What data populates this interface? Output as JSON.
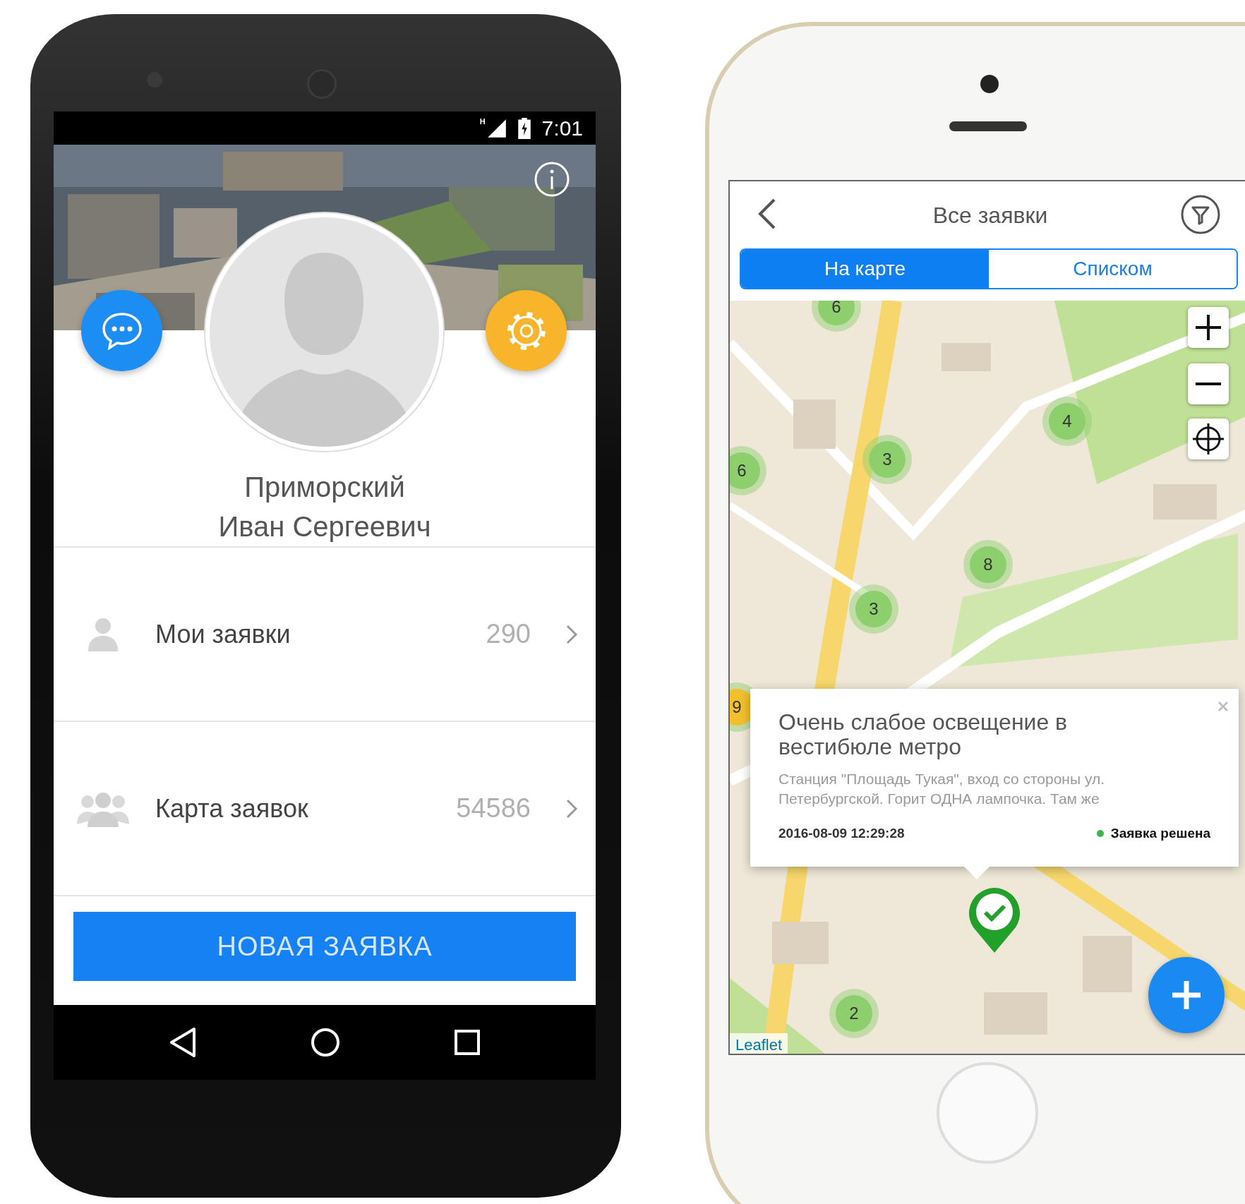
{
  "android": {
    "status_bar": {
      "network": "H",
      "time": "7:01"
    },
    "profile": {
      "name_lines": [
        "Приморский",
        "Иван Сергеевич"
      ]
    },
    "menu": [
      {
        "kind": "person",
        "label": "Мои заявки",
        "count": "290"
      },
      {
        "kind": "group",
        "label": "Карта заявок",
        "count": "54586"
      }
    ],
    "new_request_button": "НОВАЯ ЗАЯВКА"
  },
  "iphone": {
    "title": "Все заявки",
    "tabs": [
      {
        "label": "На карте",
        "selected": true
      },
      {
        "label": "Списком",
        "selected": false
      }
    ],
    "map": {
      "clusters": [
        {
          "label": "6",
          "color": "#8ccf6c"
        },
        {
          "label": "4",
          "color": "#8ccf6c"
        },
        {
          "label": "3",
          "color": "#8ccf6c"
        },
        {
          "label": "6",
          "color": "#8ccf6c"
        },
        {
          "label": "8",
          "color": "#8ccf6c"
        },
        {
          "label": "3",
          "color": "#8ccf6c"
        },
        {
          "label": "2",
          "color": "#8ccf6c"
        },
        {
          "label": "9",
          "color": "#f3c02c"
        }
      ],
      "popup": {
        "title": "Очень слабое освещение в вестибюле метро",
        "description": "Станция \"Площадь Тукая\", вход со стороны ул. Петербургской. Горит ОДНА лампочка. Там же",
        "date": "2016-08-09 12:29:28",
        "status": {
          "label": "Заявка решена",
          "color": "#3cb54a"
        }
      },
      "attribution": "Leaflet"
    }
  }
}
